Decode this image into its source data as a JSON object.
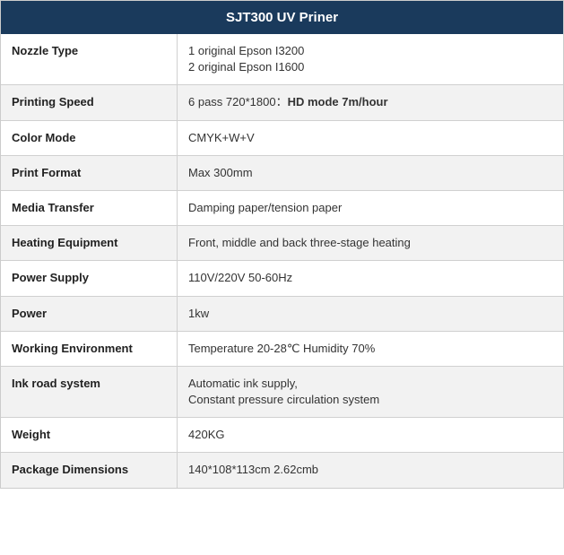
{
  "header": {
    "title": "SJT300 UV Priner"
  },
  "rows": [
    {
      "id": "nozzle-type",
      "label": "Nozzle Type",
      "value": "1 original Epson I3200\n2 original Epson I1600",
      "parity": "odd"
    },
    {
      "id": "printing-speed",
      "label": "Printing Speed",
      "value_plain": "6 pass 720*1800：",
      "value_bold": "HD mode 7m/hour",
      "parity": "even"
    },
    {
      "id": "color-mode",
      "label": "Color Mode",
      "value": "CMYK+W+V",
      "parity": "odd"
    },
    {
      "id": "print-format",
      "label": "Print Format",
      "value": "Max 300mm",
      "parity": "even"
    },
    {
      "id": "media-transfer",
      "label": "Media Transfer",
      "value": "Damping paper/tension paper",
      "parity": "odd"
    },
    {
      "id": "heating-equipment",
      "label": "Heating Equipment",
      "value": "Front, middle and back three-stage heating",
      "parity": "even"
    },
    {
      "id": "power-supply",
      "label": "Power Supply",
      "value": "110V/220V 50-60Hz",
      "parity": "odd"
    },
    {
      "id": "power",
      "label": "Power",
      "value": "1kw",
      "parity": "even"
    },
    {
      "id": "working-environment",
      "label": "Working Environment",
      "value": "Temperature 20-28℃ Humidity 70%",
      "parity": "odd"
    },
    {
      "id": "ink-road-system",
      "label": "Ink road system",
      "value": "Automatic ink supply,\nConstant pressure circulation system",
      "parity": "even"
    },
    {
      "id": "weight",
      "label": "Weight",
      "value": "420KG",
      "parity": "odd"
    },
    {
      "id": "package-dimensions",
      "label": "Package Dimensions",
      "value": "140*108*113cm 2.62cmb",
      "parity": "even"
    }
  ]
}
